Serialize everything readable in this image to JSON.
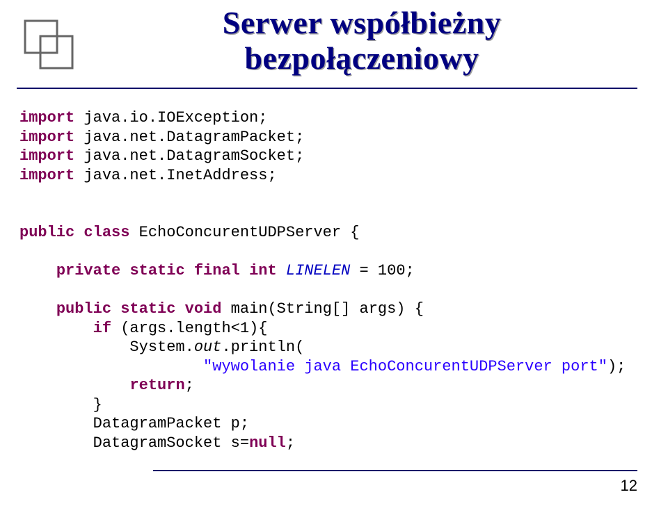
{
  "title": {
    "line1": "Serwer współbieżny",
    "line2": "bezpołączeniowy"
  },
  "code": {
    "kw_import": "import",
    "iml1": " java.io.IOException;",
    "iml2": " java.net.DatagramPacket;",
    "iml3": " java.net.DatagramSocket;",
    "iml4": " java.net.InetAddress;",
    "kw_public": "public",
    "kw_class": "class",
    "class_name": " EchoConcurentUDPServer {",
    "kw_private": "private",
    "kw_static": "static",
    "kw_final": "final",
    "kw_int": "int",
    "const_name": "LINELEN",
    "const_assign": " = 100;",
    "kw_void": "void",
    "main_sig": " main(String[] args) {",
    "kw_if": "if",
    "if_cond": " (args.length<1){",
    "sys": "            System.",
    "out": "out",
    "println": ".println(",
    "str_msg": "\"wywolanie java EchoConcurentUDPServer port\"",
    "close_paren": ");",
    "kw_return": "return",
    "semi": ";",
    "brace_close": "        }",
    "dp_line": "        DatagramPacket p;",
    "ds_line1": "        DatagramSocket s=",
    "kw_null": "null",
    "ds_line2": ";"
  },
  "page_number": "12"
}
